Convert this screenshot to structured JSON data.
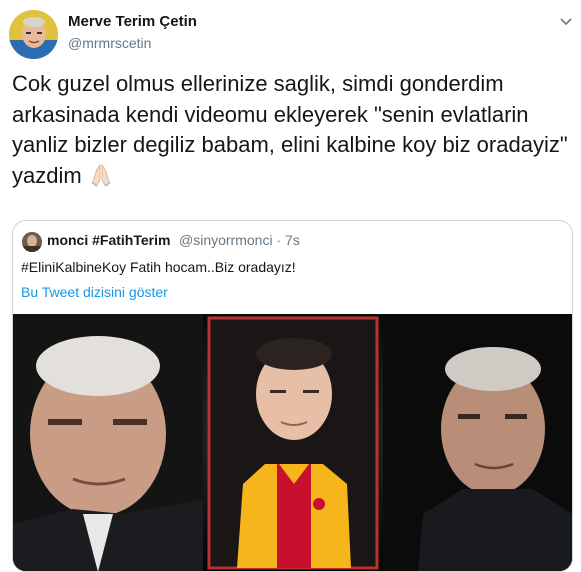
{
  "tweet": {
    "author_name": "Merve Terim Çetin",
    "author_handle": "@mrmrscetin",
    "text": "Cok guzel olmus ellerinize saglik, simdi gonderdim arkasinada kendi videomu ekleyerek \"senin evlatlarin yanliz bizler degiliz babam, elini kalbine koy biz oradayiz\" yazdim",
    "emoji": "folded-hands-emoji"
  },
  "quoted_tweet": {
    "author_name": "monci #FatihTerim",
    "author_handle": "@sinyorrmonci",
    "separator": "·",
    "time": "7s",
    "text": "#EliniKalbineKoy Fatih hocam..Biz oradayız!",
    "thread_link": "Bu Tweet dizisini göster"
  },
  "media": {
    "panels": [
      "left-portrait",
      "center-portrait-in-jersey",
      "right-portrait"
    ],
    "border_color": "#b8322e",
    "jersey_colors": [
      "#f5b51b",
      "#c8102e"
    ]
  }
}
